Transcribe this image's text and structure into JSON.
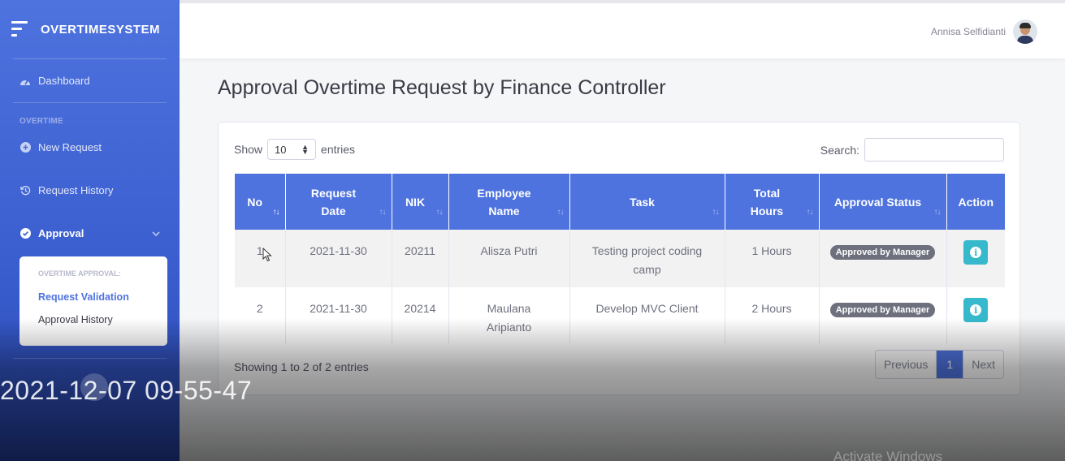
{
  "sidebar": {
    "brand": "OVERTIMESYSTEM",
    "dashboard": "Dashboard",
    "heading": "OVERTIME",
    "new_request": "New Request",
    "request_history": "Request History",
    "approval": "Approval",
    "submenu": {
      "heading": "OVERTIME APPROVAL:",
      "items": [
        "Request Validation",
        "Approval History"
      ]
    }
  },
  "topbar": {
    "user_name": "Annisa Selfidianti"
  },
  "page_title": "Approval Overtime Request by Finance Controller",
  "table_controls": {
    "show_label": "Show",
    "page_size": "10",
    "entries_label": "entries",
    "search_label": "Search:"
  },
  "table": {
    "columns": [
      "No",
      "Request Date",
      "NIK",
      "Employee Name",
      "Task",
      "Total Hours",
      "Approval Status",
      "Action"
    ],
    "rows": [
      {
        "no": "1",
        "date": "2021-11-30",
        "nik": "20211",
        "name": "Alisza Putri",
        "task": "Testing project coding camp",
        "hours": "1 Hours",
        "status": "Approved by Manager"
      },
      {
        "no": "2",
        "date": "2021-11-30",
        "nik": "20214",
        "name": "Maulana Aripianto",
        "task": "Develop MVC Client",
        "hours": "2 Hours",
        "status": "Approved by Manager"
      }
    ]
  },
  "footer": {
    "info": "Showing 1 to 2 of 2 entries",
    "prev": "Previous",
    "page": "1",
    "next": "Next"
  },
  "overlay": {
    "timestamp": "2021-12-07 09-55-47",
    "watermark": "Activate Windows"
  },
  "colors": {
    "primary": "#4e73df",
    "info": "#36b9cc",
    "badge": "#6e707e"
  }
}
